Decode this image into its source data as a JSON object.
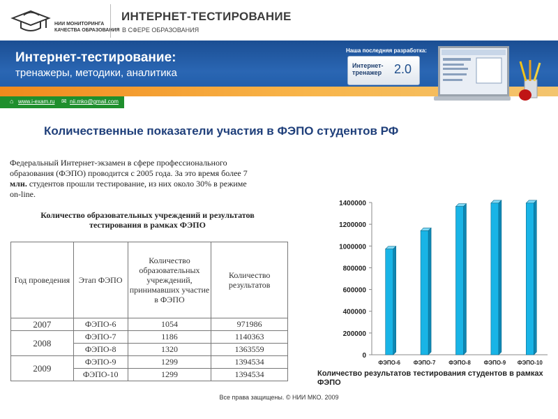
{
  "header": {
    "logo_text_line1": "НИИ МОНИТОРИНГА",
    "logo_text_line2": "КАЧЕСТВА ОБРАЗОВАНИЯ",
    "brand_title": "ИНТЕРНЕТ-ТЕСТИРОВАНИЕ",
    "brand_subtitle": "В СФЕРЕ ОБРАЗОВАНИЯ"
  },
  "banner": {
    "title": "Интернет-тестирование:",
    "subtitle": "тренажеры, методики, аналитика",
    "promo_label": "Наша последняя разработка:",
    "promo_name_line1": "Интернет-",
    "promo_name_line2": "тренажер",
    "promo_version": "2.0"
  },
  "links": {
    "site": "www.i-exam.ru",
    "email": "nii.mko@gmail.com"
  },
  "headline": "Количественные показатели участия  в ФЭПО студентов РФ",
  "paragraph": {
    "part1": "Федеральный Интернет-экзамен в сфере профессионального образования (ФЭПО) проводится с 2005 года. За это время более 7 ",
    "bold": "млн.",
    "part2": " студентов прошли тестирование, из них около 30% в режиме on-line."
  },
  "table_caption_line1": "Количество образовательных учреждений и результатов",
  "table_caption_line2": "тестирования в рамках ФЭПО",
  "table": {
    "headers": [
      "Год проведения",
      "Этап ФЭПО",
      "Количество образовательных учреждений, принимавших участие в ФЭПО",
      "Количество результатов"
    ],
    "rows": [
      {
        "year": "2007",
        "stage": "ФЭПО-6",
        "institutions": "1054",
        "results": "971986"
      },
      {
        "year": "2008",
        "stage": "ФЭПО-7",
        "institutions": "1186",
        "results": "1140363"
      },
      {
        "year": "",
        "stage": "ФЭПО-8",
        "institutions": "1320",
        "results": "1363559"
      },
      {
        "year": "2009",
        "stage": "ФЭПО-9",
        "institutions": "1299",
        "results": "1394534"
      },
      {
        "year": "",
        "stage": "ФЭПО-10",
        "institutions": "1299",
        "results": "1394534"
      }
    ]
  },
  "chart_data": {
    "type": "bar",
    "categories": [
      "ФЭПО-6",
      "ФЭПО-7",
      "ФЭПО-8",
      "ФЭПО-9",
      "ФЭПО-10"
    ],
    "values": [
      971986,
      1140363,
      1363559,
      1394534,
      1394534
    ],
    "ylim": [
      0,
      1400000
    ],
    "yticks": [
      0,
      200000,
      400000,
      600000,
      800000,
      1000000,
      1200000,
      1400000
    ],
    "ytick_labels": [
      "0",
      "200000",
      "400000",
      "600000",
      "800000",
      "1000000",
      "1200000",
      "1400000"
    ],
    "bar_color": "#19b4e6",
    "grid": false,
    "caption": "Количество результатов тестирования студентов в рамках ФЭПО"
  },
  "footer": "Все права защищены. © НИИ МКО. 2009"
}
